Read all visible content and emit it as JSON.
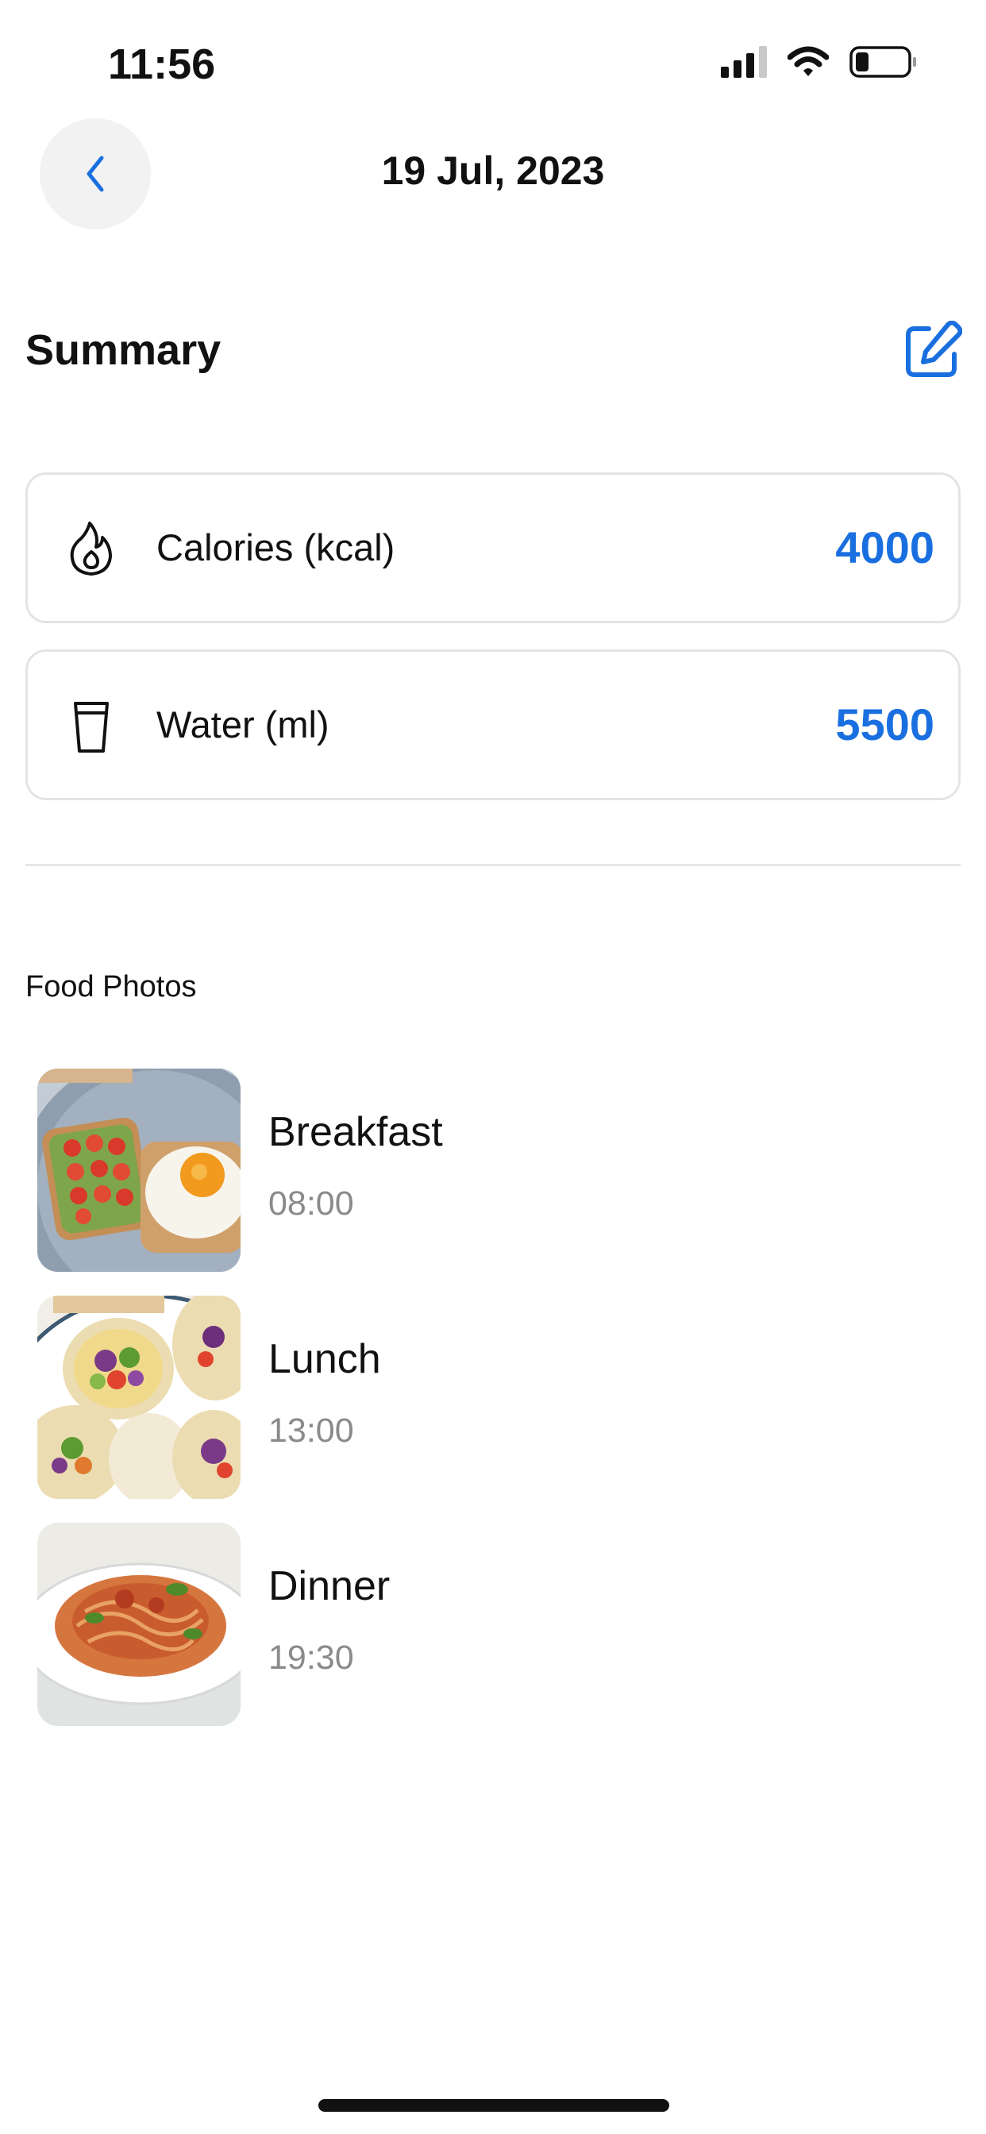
{
  "status_bar": {
    "time": "11:56",
    "icons": [
      "cellular-signal-icon",
      "wifi-icon",
      "battery-icon"
    ]
  },
  "header": {
    "back_icon": "chevron-left-icon",
    "date": "19 Jul, 2023"
  },
  "summary": {
    "title": "Summary",
    "edit_icon": "edit-icon",
    "stats": [
      {
        "icon": "flame-icon",
        "label": "Calories (kcal)",
        "value": "4000"
      },
      {
        "icon": "cup-icon",
        "label": "Water (ml)",
        "value": "5500"
      }
    ]
  },
  "food_photos": {
    "title": "Food Photos",
    "meals": [
      {
        "name": "Breakfast",
        "time": "08:00",
        "photo": "avocado-toast-and-egg-photo"
      },
      {
        "name": "Lunch",
        "time": "13:00",
        "photo": "veggie-wraps-photo"
      },
      {
        "name": "Dinner",
        "time": "19:30",
        "photo": "spaghetti-photo"
      }
    ]
  },
  "colors": {
    "accent": "#1a6fe0",
    "text": "#111111",
    "muted_text": "#8a8a8a",
    "card_border": "#e4e4e4",
    "back_button_bg": "#f2f2f2"
  }
}
